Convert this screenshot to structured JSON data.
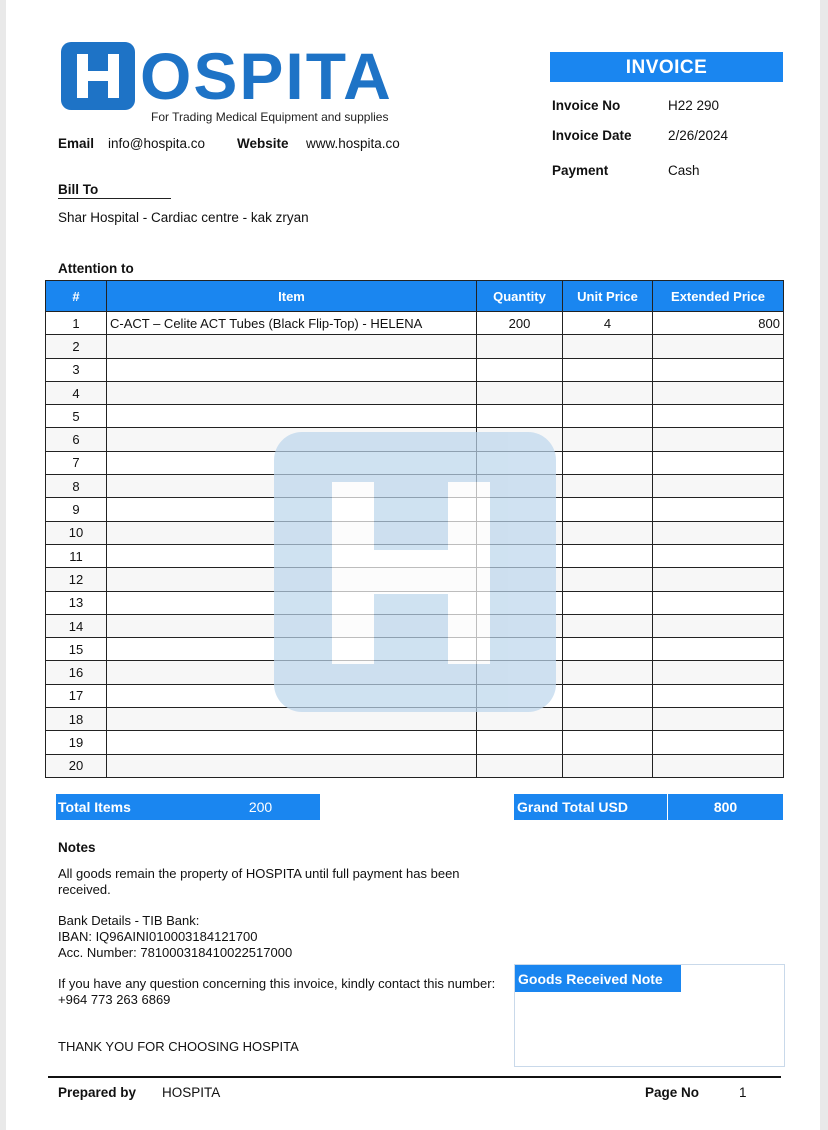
{
  "company": {
    "name": "HOSPITA",
    "logo_letter": "H",
    "logo_rest": "OSPITA",
    "tagline": "For Trading Medical Equipment and supplies",
    "email_label": "Email",
    "email": "info@hospita.co",
    "website_label": "Website",
    "website": "www.hospita.co"
  },
  "invoice": {
    "heading": "INVOICE",
    "no_label": "Invoice No",
    "no": "H22 290",
    "date_label": "Invoice Date",
    "date": "2/26/2024",
    "payment_label": "Payment",
    "payment": "Cash"
  },
  "bill_to": {
    "label": "Bill To",
    "value": "Shar Hospital - Cardiac centre - kak zryan",
    "attention_label": "Attention to"
  },
  "table": {
    "headers": [
      "#",
      "Item",
      "Quantity",
      "Unit Price",
      "Extended Price"
    ],
    "rows": [
      [
        "1",
        "C-ACT –  Celite ACT Tubes (Black Flip-Top) - HELENA",
        "200",
        "4",
        "800"
      ],
      [
        "2",
        "",
        "",
        "",
        ""
      ],
      [
        "3",
        "",
        "",
        "",
        ""
      ],
      [
        "4",
        "",
        "",
        "",
        ""
      ],
      [
        "5",
        "",
        "",
        "",
        ""
      ],
      [
        "6",
        "",
        "",
        "",
        ""
      ],
      [
        "7",
        "",
        "",
        "",
        ""
      ],
      [
        "8",
        "",
        "",
        "",
        ""
      ],
      [
        "9",
        "",
        "",
        "",
        ""
      ],
      [
        "10",
        "",
        "",
        "",
        ""
      ],
      [
        "11",
        "",
        "",
        "",
        ""
      ],
      [
        "12",
        "",
        "",
        "",
        ""
      ],
      [
        "13",
        "",
        "",
        "",
        ""
      ],
      [
        "14",
        "",
        "",
        "",
        ""
      ],
      [
        "15",
        "",
        "",
        "",
        ""
      ],
      [
        "16",
        "",
        "",
        "",
        ""
      ],
      [
        "17",
        "",
        "",
        "",
        ""
      ],
      [
        "18",
        "",
        "",
        "",
        ""
      ],
      [
        "19",
        "",
        "",
        "",
        ""
      ],
      [
        "20",
        "",
        "",
        "",
        ""
      ]
    ]
  },
  "totals": {
    "items_label": "Total Items",
    "items_value": "200",
    "grand_label": "Grand Total USD",
    "grand_value": "800"
  },
  "notes": {
    "heading": "Notes",
    "ownership": "All goods remain the property of HOSPITA until full payment has been received.",
    "bank_title": "Bank Details - TIB Bank:",
    "iban": "IBAN: IQ96AINI010003184121700",
    "account": "Acc. Number: 781000318410022517000",
    "contact": "If you have any question concerning this invoice, kindly contact this number: +964 773 263 6869",
    "thanks": "THANK YOU FOR CHOOSING HOSPITA"
  },
  "goods_received": {
    "label": "Goods Received Note"
  },
  "footer": {
    "prepared_label": "Prepared by",
    "prepared_value": "HOSPITA",
    "page_label": "Page No",
    "page_value": "1"
  },
  "colors": {
    "accent": "#1a86f0",
    "logo": "#1e73c6",
    "watermark": "#bcd6ec"
  },
  "icons": {
    "logo": "hospita-h-logo-icon",
    "watermark": "hospita-h-watermark-icon"
  }
}
